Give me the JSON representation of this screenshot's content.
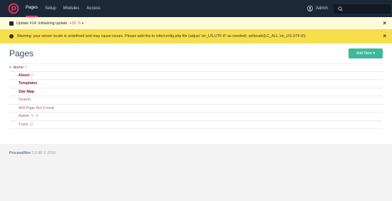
{
  "topbar": {
    "nav": [
      "Pages",
      "Setup",
      "Modules",
      "Access"
    ],
    "user": "Admin"
  },
  "notice_update": {
    "text": "Update #14: Initializing update",
    "progress": "+19",
    "progress_icons": "↻ ▸"
  },
  "notice_warning": {
    "text": "Warning: your server locale is undefined and may cause issues. Please add this to /site/config.php file (adjust “en_US.UTF-8” as needed): setlocale(LC_ALL,'en_US.UTF-8');"
  },
  "page": {
    "title": "Pages",
    "add_new": "Add New ▾"
  },
  "tree": {
    "home": {
      "label": "Home",
      "count": "7"
    },
    "items": [
      {
        "label": "About",
        "count": "2"
      },
      {
        "label": "Templates"
      },
      {
        "label": "Site Map"
      },
      {
        "label": "Search"
      },
      {
        "label": "404 Page Not Found"
      },
      {
        "label": "Admin"
      },
      {
        "label": "Trash"
      }
    ]
  },
  "footer": {
    "name": "ProcessWire",
    "version": "3.0.98 © 2018"
  },
  "colors": {
    "topbar": "#1c2836",
    "accent": "#e83561",
    "add_button": "#3eb998",
    "warning_bg": "#f7de4c",
    "notice_bg": "#fdfbd8"
  }
}
